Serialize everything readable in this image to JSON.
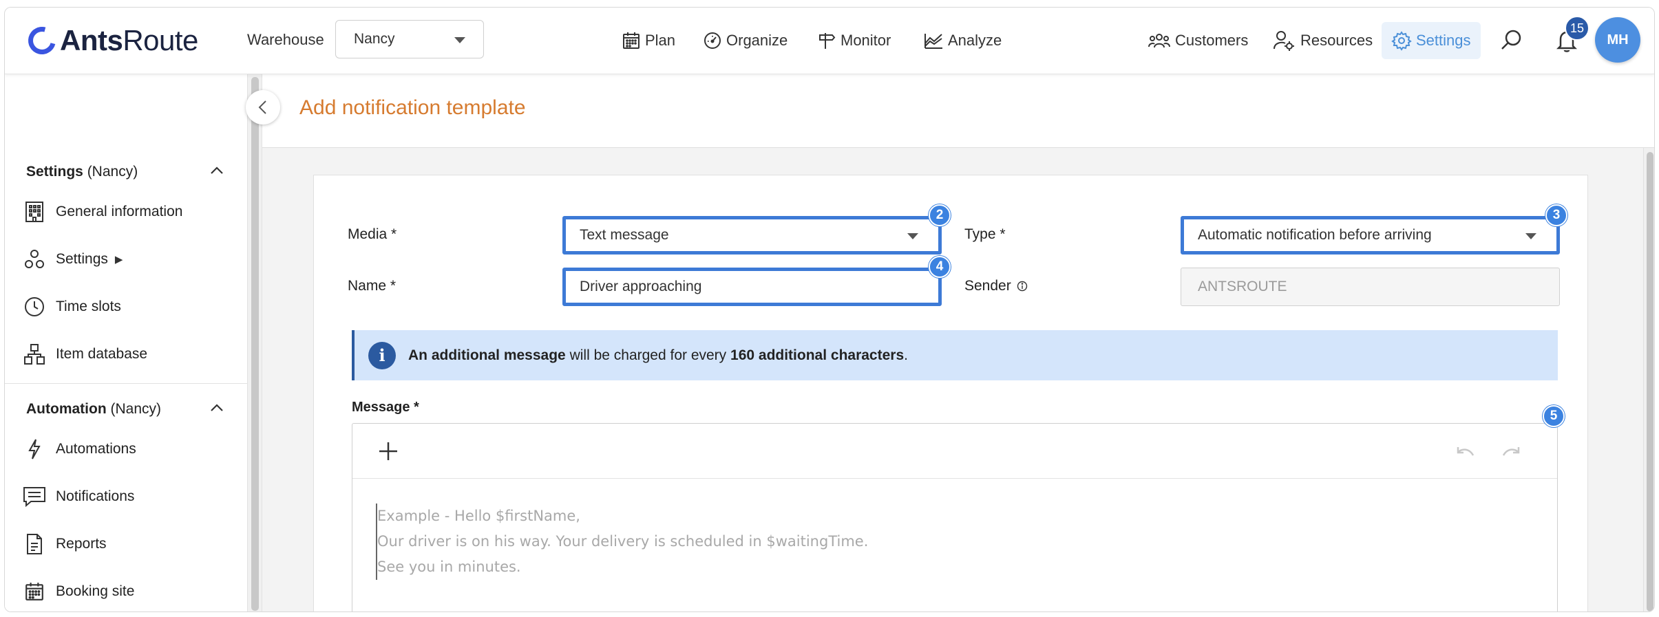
{
  "app": {
    "name_bold": "Ants",
    "name_rest": "Route",
    "brand_color": "#3a55e0"
  },
  "header": {
    "warehouse_label": "Warehouse",
    "warehouse_value": "Nancy",
    "nav": [
      {
        "label": "Plan",
        "icon": "calendar-icon"
      },
      {
        "label": "Organize",
        "icon": "gauge-icon"
      },
      {
        "label": "Monitor",
        "icon": "signpost-icon"
      },
      {
        "label": "Analyze",
        "icon": "chart-icon"
      },
      {
        "label": "Customers",
        "icon": "people-icon"
      },
      {
        "label": "Resources",
        "icon": "user-gear-icon"
      },
      {
        "label": "Settings",
        "icon": "gear-icon"
      }
    ],
    "notification_count": "15",
    "avatar_initials": "MH"
  },
  "sidebar": {
    "settings_title": "Settings",
    "settings_scope": "(Nancy)",
    "settings_items": [
      {
        "label": "General information",
        "icon": "building-icon"
      },
      {
        "label": "Settings",
        "icon": "shapes-icon",
        "suffix": "▶"
      },
      {
        "label": "Time slots",
        "icon": "clock-icon"
      },
      {
        "label": "Item database",
        "icon": "boxes-icon"
      }
    ],
    "automation_title": "Automation",
    "automation_scope": "(Nancy)",
    "automation_items": [
      {
        "label": "Automations",
        "icon": "bolt-icon"
      },
      {
        "label": "Notifications",
        "icon": "message-icon"
      },
      {
        "label": "Reports",
        "icon": "document-icon"
      },
      {
        "label": "Booking site",
        "icon": "calendar-icon"
      }
    ]
  },
  "page": {
    "title": "Add notification template"
  },
  "form": {
    "media_label": "Media *",
    "media_value": "Text message",
    "type_label": "Type *",
    "type_value": "Automatic notification before arriving",
    "name_label": "Name *",
    "name_value": "Driver approaching",
    "sender_label": "Sender",
    "sender_value": "ANTSROUTE",
    "markers": [
      "2",
      "3",
      "4",
      "5"
    ]
  },
  "info": {
    "part1": "An additional message",
    "part2": " will be charged for every ",
    "part3": "160 additional characters",
    "part4": "."
  },
  "message": {
    "label": "Message *",
    "placeholder_lines": [
      "Example - Hello $firstName,",
      "Our driver is on his way. Your delivery is scheduled in $waitingTime.",
      "See you in minutes."
    ]
  }
}
